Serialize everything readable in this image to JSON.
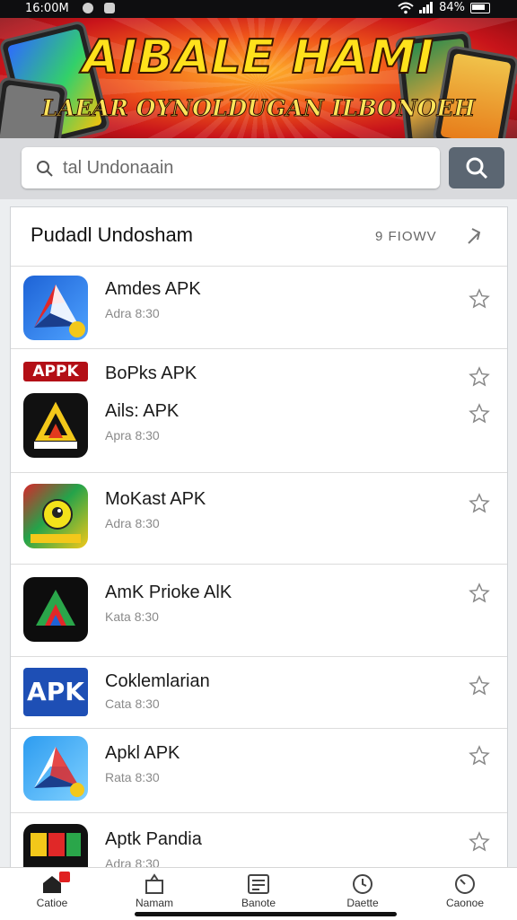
{
  "status_bar": {
    "time": "16:00M",
    "battery": "84%"
  },
  "banner": {
    "title": "AIBALE HAMI",
    "subtitle": "LAEAR OYNOLDUGAN ILBONOEH"
  },
  "search": {
    "placeholder": "tal Undonaain"
  },
  "section": {
    "title": "Pudadl Undosham",
    "more_label": "9 FIOWV"
  },
  "apps": [
    {
      "name": "Amdes APK",
      "sub": "Adra 8:30"
    },
    {
      "badge": "APPK",
      "name": "BoPks APK"
    },
    {
      "name": "Ails: APK",
      "sub": "Apra 8:30"
    },
    {
      "name": "MoKast APK",
      "sub": "Adra 8:30"
    },
    {
      "name": "AmK Prioke AlK",
      "sub": "Kata 8:30"
    },
    {
      "name": "Coklemlarian",
      "sub": "Cata 8:30",
      "icon_text": "APK"
    },
    {
      "name": "Apkl APK",
      "sub": "Rata 8:30"
    },
    {
      "name": "Aptk Pandia",
      "sub": "Adra 8:30"
    }
  ],
  "bottom_nav": [
    {
      "label": "Catioe",
      "icon": "home-icon"
    },
    {
      "label": "Namam",
      "icon": "bag-icon"
    },
    {
      "label": "Banote",
      "icon": "list-icon"
    },
    {
      "label": "Daette",
      "icon": "clock-icon"
    },
    {
      "label": "Caonoe",
      "icon": "gauge-icon"
    }
  ],
  "colors": {
    "banner_red": "#c8141a",
    "banner_yellow": "#ffe11c",
    "search_button": "#5b6672",
    "badge_red": "#e02020"
  }
}
